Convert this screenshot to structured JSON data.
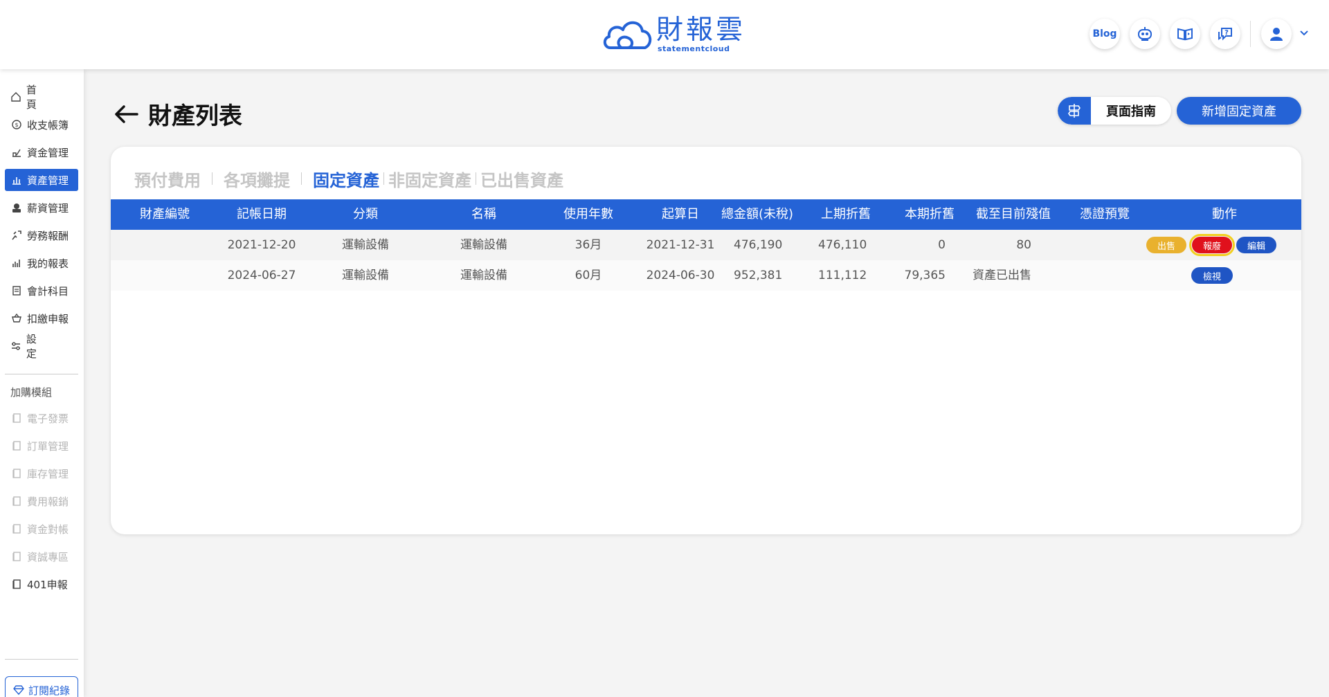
{
  "header": {
    "logo_main": "財報雲",
    "logo_sub": "statementcloud",
    "blog_label": "Blog",
    "icons": [
      "robot-icon",
      "video-tutorial-icon",
      "help-chat-icon",
      "user-avatar-icon",
      "chevron-down-icon"
    ]
  },
  "sidebar": {
    "items": [
      {
        "label": "首頁",
        "icon": "home-icon"
      },
      {
        "label": "收支帳簿",
        "icon": "coin-icon"
      },
      {
        "label": "資金管理",
        "icon": "fund-icon"
      },
      {
        "label": "資產管理",
        "icon": "asset-chart-icon"
      },
      {
        "label": "薪資管理",
        "icon": "salary-icon"
      },
      {
        "label": "勞務報酬",
        "icon": "labor-icon"
      },
      {
        "label": "我的報表",
        "icon": "report-bars-icon"
      },
      {
        "label": "會計科目",
        "icon": "ledger-icon"
      },
      {
        "label": "扣繳申報",
        "icon": "withholding-icon"
      },
      {
        "label": "設定",
        "icon": "settings-slider-icon"
      }
    ],
    "addon_title": "加購模組",
    "addons": [
      {
        "label": "電子發票",
        "icon": "module-book-icon"
      },
      {
        "label": "訂單管理",
        "icon": "module-book-icon"
      },
      {
        "label": "庫存管理",
        "icon": "module-book-icon"
      },
      {
        "label": "費用報銷",
        "icon": "module-book-icon"
      },
      {
        "label": "資金對帳",
        "icon": "module-book-icon"
      },
      {
        "label": "資誠專區",
        "icon": "module-book-icon"
      },
      {
        "label": "401申報",
        "icon": "module-book-icon"
      }
    ],
    "subscription_label": "訂閱紀錄"
  },
  "page": {
    "title": "財產列表",
    "guide_label": "頁面指南",
    "add_label": "新增固定資產"
  },
  "tabs": [
    "預付費用",
    "各項攤提",
    "固定資產",
    "非固定資產",
    "已出售資產"
  ],
  "active_tab": "固定資產",
  "table": {
    "columns": [
      "財產編號",
      "記帳日期",
      "分類",
      "名稱",
      "使用年數",
      "起算日",
      "總金額(未稅)",
      "上期折舊",
      "本期折舊",
      "截至目前殘值",
      "憑證預覽",
      "動作"
    ],
    "rows": [
      {
        "asset_no": "",
        "date": "2021-12-20",
        "category": "運輸設備",
        "name": "運輸設備",
        "years": "36月",
        "start": "2021-12-31",
        "total": "476,190",
        "prev_dep": "476,110",
        "curr_dep": "0",
        "residual": "80",
        "actions": [
          "出售",
          "報廢",
          "編輯"
        ]
      },
      {
        "asset_no": "",
        "date": "2024-06-27",
        "category": "運輸設備",
        "name": "運輸設備",
        "years": "60月",
        "start": "2024-06-30",
        "total": "952,381",
        "prev_dep": "111,112",
        "curr_dep": "79,365",
        "residual": "資產已出售",
        "actions": [
          "檢視"
        ]
      }
    ]
  },
  "colors": {
    "brand_blue": "#2563d6",
    "sell_yellow": "#e9b12e",
    "scrap_red": "#e0111c",
    "highlight_yellow": "#f2cf1d"
  }
}
